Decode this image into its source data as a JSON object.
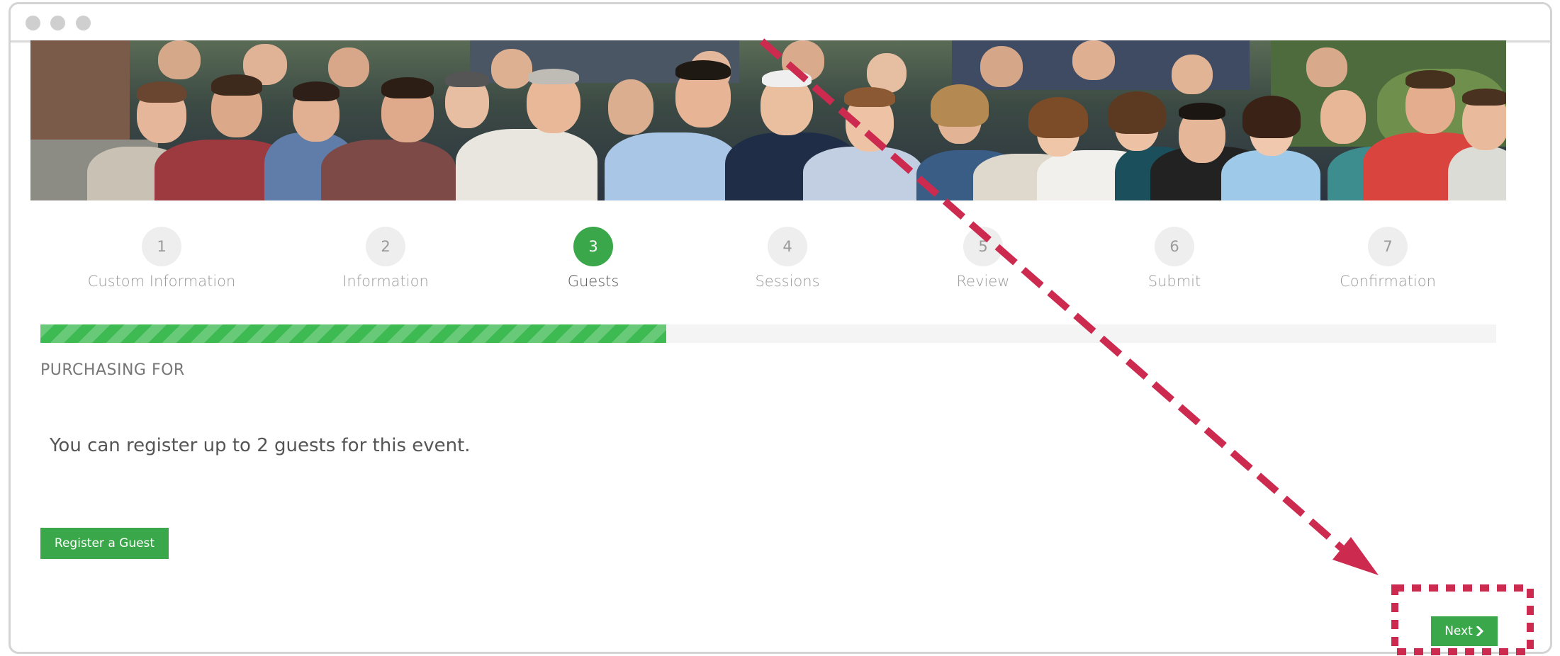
{
  "window": {
    "traffic_lights": [
      "close-dot",
      "minimize-dot",
      "maximize-dot"
    ],
    "accent_color": "#3aa84a",
    "annotation_color": "#cc2b4f"
  },
  "banner": {
    "kind": "group-photo"
  },
  "steps": [
    {
      "number": "1",
      "label": "Custom Information",
      "active": false
    },
    {
      "number": "2",
      "label": "Information",
      "active": false
    },
    {
      "number": "3",
      "label": "Guests",
      "active": true
    },
    {
      "number": "4",
      "label": "Sessions",
      "active": false
    },
    {
      "number": "5",
      "label": "Review",
      "active": false
    },
    {
      "number": "6",
      "label": "Submit",
      "active": false
    },
    {
      "number": "7",
      "label": "Confirmation",
      "active": false
    }
  ],
  "progress": {
    "fraction": 0.43
  },
  "section": {
    "title": "PURCHASING FOR"
  },
  "guests": {
    "info": "You can register up to 2 guests for this event."
  },
  "buttons": {
    "register_guest": "Register a Guest",
    "next": "Next"
  },
  "icons": {
    "next_arrow": "chevron-right-icon"
  }
}
